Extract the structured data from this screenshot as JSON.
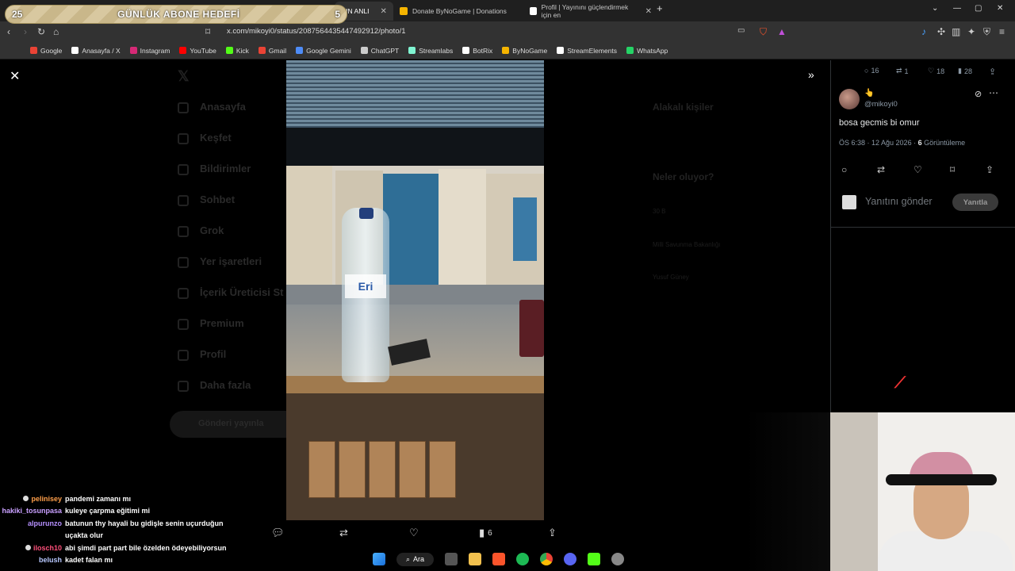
{
  "goal": {
    "current": "25",
    "title": "GÜNLÜK ABONE HEDEFİ",
    "target": "5"
  },
  "tabs": [
    {
      "label": "DIN ANLI",
      "active": true
    },
    {
      "label": "Donate ByNoGame | Donations",
      "active": false
    },
    {
      "label": "Profil | Yayınını güçlendirmek için en",
      "active": false
    }
  ],
  "new_tab": "+",
  "url": "x.com/mikoyi0/status/2087564435447492912/photo/1",
  "bookmarks": [
    {
      "label": "Google",
      "color": "#ea4335"
    },
    {
      "label": "Anasayfa / X",
      "color": "#ffffff"
    },
    {
      "label": "Instagram",
      "color": "#d62976"
    },
    {
      "label": "YouTube",
      "color": "#ff0000"
    },
    {
      "label": "Kick",
      "color": "#53fc18"
    },
    {
      "label": "Gmail",
      "color": "#ea4335"
    },
    {
      "label": "Google Gemini",
      "color": "#4e8cf7"
    },
    {
      "label": "ChatGPT",
      "color": "#cccccc"
    },
    {
      "label": "Streamlabs",
      "color": "#80f5d2"
    },
    {
      "label": "BotRix",
      "color": "#ffffff"
    },
    {
      "label": "ByNoGame",
      "color": "#f5b400"
    },
    {
      "label": "StreamElements",
      "color": "#ffffff"
    },
    {
      "label": "WhatsApp",
      "color": "#25d366"
    }
  ],
  "background_nav": [
    "Anasayfa",
    "Keşfet",
    "Bildirimler",
    "Sohbet",
    "Grok",
    "Yer işaretleri",
    "İçerik Üreticisi St",
    "Premium",
    "Profil",
    "Daha fazla"
  ],
  "background_post_button": "Gönderi yayınla",
  "background_right": {
    "who_to_follow": "Alakalı kişiler",
    "trending": "Neler oluyor?",
    "items": [
      "30 B",
      "Milli Savunma Bakanlığı",
      "Yusuf Güney"
    ]
  },
  "photo": {
    "bottle_brand": "Eri"
  },
  "photo_actions": {
    "views": "6"
  },
  "tweet": {
    "stats": {
      "replies": "16",
      "reposts": "1",
      "likes": "18",
      "views": "28"
    },
    "emoji": "👆",
    "handle": "@mikoyi0",
    "text": "bosa gecmis bi omur",
    "time": "ÖS 6:38 · 12 Ağu 2026 ·",
    "views_count": "6",
    "views_label": "Görüntüleme",
    "reply_placeholder": "Yanıtını gönder",
    "reply_button": "Yanıtla"
  },
  "chat": [
    {
      "user": "pelinisey",
      "color": "#ff9f4a",
      "msg": "pandemi zamanı mı",
      "badge": true
    },
    {
      "user": "hakiki_tosunpasa",
      "color": "#c9a0ff",
      "msg": "kuleye çarpma eğitimi mi",
      "badge": false
    },
    {
      "user": "alpurunzo",
      "color": "#b690ff",
      "msg": "batunun thy hayali bu gidişle senin uçurduğun",
      "badge": false
    },
    {
      "user": "",
      "color": "#ffffff",
      "msg": "uçakta olur",
      "badge": false
    },
    {
      "user": "ilosch10",
      "color": "#ff4f7a",
      "msg": "abi şimdi part part bile özelden ödeyebiliyorsun",
      "badge": true
    },
    {
      "user": "belush",
      "color": "#b8c8ff",
      "msg": "kadet falan mı",
      "badge": false
    }
  ],
  "taskbar": {
    "search_label": "Ara"
  }
}
